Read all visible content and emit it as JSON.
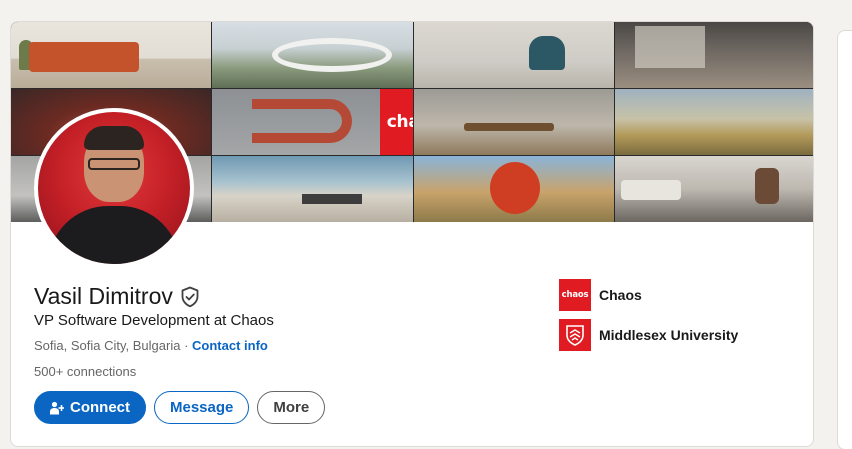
{
  "profile": {
    "name": "Vasil Dimitrov",
    "headline": "VP Software Development at Chaos",
    "location": "Sofia, Sofia City, Bulgaria",
    "location_separator": " · ",
    "contact_link": "Contact info",
    "connections": "500+ connections"
  },
  "banner": {
    "logo_text": "chaos"
  },
  "actions": {
    "connect_label": "Connect",
    "message_label": "Message",
    "more_label": "More"
  },
  "organizations": [
    {
      "name": "Chaos",
      "logo_text": "chaos",
      "logo_color": "#e01b22"
    },
    {
      "name": "Middlesex University",
      "logo_text": "",
      "logo_color": "#e01b22"
    }
  ],
  "colors": {
    "brand_blue": "#0a66c2",
    "chaos_red": "#e01b22",
    "page_bg": "#f3f2ef"
  },
  "icons": {
    "verified": "shield-check-icon",
    "connect": "person-add-icon",
    "university": "crest-icon"
  }
}
